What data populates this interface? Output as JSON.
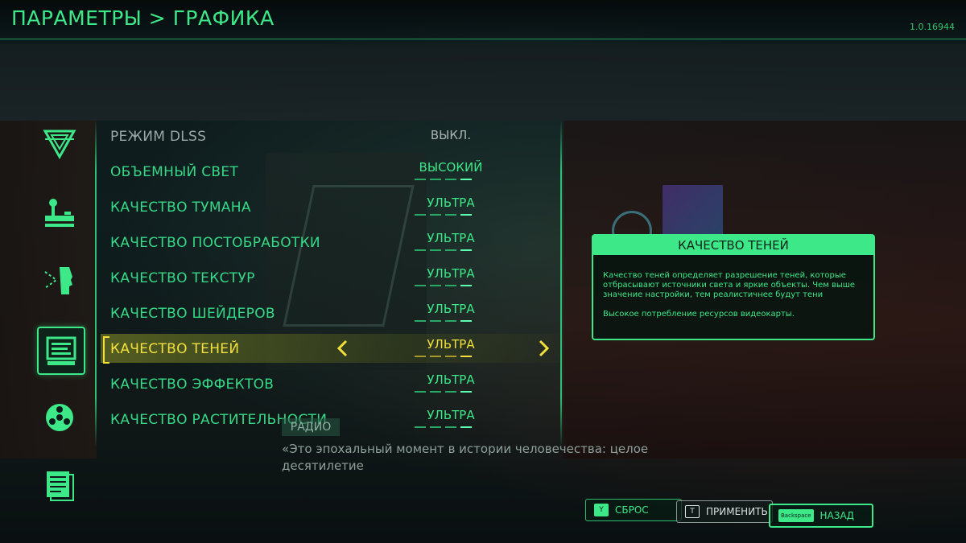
{
  "header": {
    "title": "ПАРАМЕТРЫ > ГРАФИКА",
    "version": "1.0.16944"
  },
  "nav": [
    {
      "icon": "triangle-logo-icon",
      "active": false
    },
    {
      "icon": "joystick-icon",
      "active": false
    },
    {
      "icon": "head-profile-icon",
      "active": false
    },
    {
      "icon": "monitor-icon",
      "active": true
    },
    {
      "icon": "reel-icon",
      "active": false
    },
    {
      "icon": "documents-icon",
      "active": false
    }
  ],
  "settings": [
    {
      "label": "РЕЖИМ DLSS",
      "value": "ВЫКЛ.",
      "state": "disabled",
      "level": 0
    },
    {
      "label": "ОБЪЕМНЫЙ СВЕТ",
      "value": "ВЫСОКИЙ",
      "state": "normal",
      "level": 4
    },
    {
      "label": "КАЧЕСТВО ТУМАНА",
      "value": "УЛЬТРА",
      "state": "normal",
      "level": 5
    },
    {
      "label": "КАЧЕСТВО ПОСТОБРАБОТКИ",
      "value": "УЛЬТРА",
      "state": "normal",
      "level": 5
    },
    {
      "label": "КАЧЕСТВО ТЕКСТУР",
      "value": "УЛЬТРА",
      "state": "normal",
      "level": 5
    },
    {
      "label": "КАЧЕСТВО ШЕЙДЕРОВ",
      "value": "УЛЬТРА",
      "state": "normal",
      "level": 5
    },
    {
      "label": "КАЧЕСТВО ТЕНЕЙ",
      "value": "УЛЬТРА",
      "state": "selected",
      "level": 5
    },
    {
      "label": "КАЧЕСТВО ЭФФЕКТОВ",
      "value": "УЛЬТРА",
      "state": "normal",
      "level": 5
    },
    {
      "label": "КАЧЕСТВО РАСТИТЕЛЬНОСТИ",
      "value": "УЛЬТРА",
      "state": "normal",
      "level": 5
    }
  ],
  "info": {
    "title": "КАЧЕСТВО ТЕНЕЙ",
    "description": "Качество теней определяет разрешение теней, которые отбрасывают источники света и яркие объекты. Чем выше значение настройки, тем реалистичнее будут тени",
    "cost": "Высокое потребление ресурсов видеокарты."
  },
  "radio": {
    "tag": "РАДИО",
    "text": "«Это эпохальный момент в истории человечества: целое десятилетие"
  },
  "buttons": {
    "reset": {
      "key": "Y",
      "label": "СБРОС"
    },
    "apply": {
      "key": "T",
      "label": "ПРИМЕНИТЬ"
    },
    "back": {
      "key": "Backspace",
      "label": "НАЗАД"
    }
  },
  "colors": {
    "accent": "#3de889",
    "selected": "#f2e03b",
    "disabled": "#9aa7a4"
  }
}
